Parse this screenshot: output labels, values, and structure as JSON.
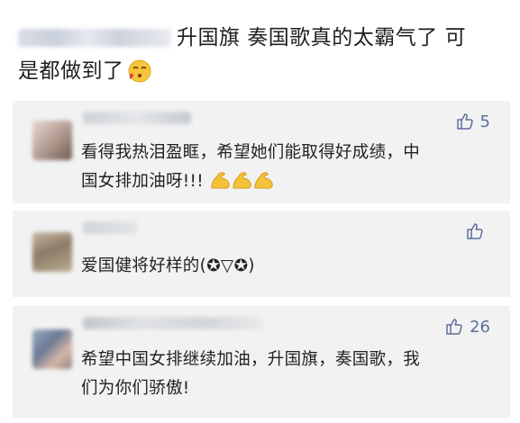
{
  "post": {
    "line1": "升国旗 奏国歌真的太霸气了 可",
    "line2": "是都做到了"
  },
  "comments": [
    {
      "text_line1": "看得我热泪盈眶，希望她们能取得好成绩，中",
      "text_line2": "国女排加油呀!!!",
      "likes": "5"
    },
    {
      "text_line1": "爱国健将好样的(✪▽✪)",
      "likes": ""
    },
    {
      "text_line1": "希望中国女排继续加油，升国旗，奏国歌，我",
      "text_line2": "们为你们骄傲!",
      "likes": "26"
    }
  ],
  "colors": {
    "card_bg": "#f2f2f2",
    "like_blue": "#5a6f9b",
    "text": "#222222"
  }
}
